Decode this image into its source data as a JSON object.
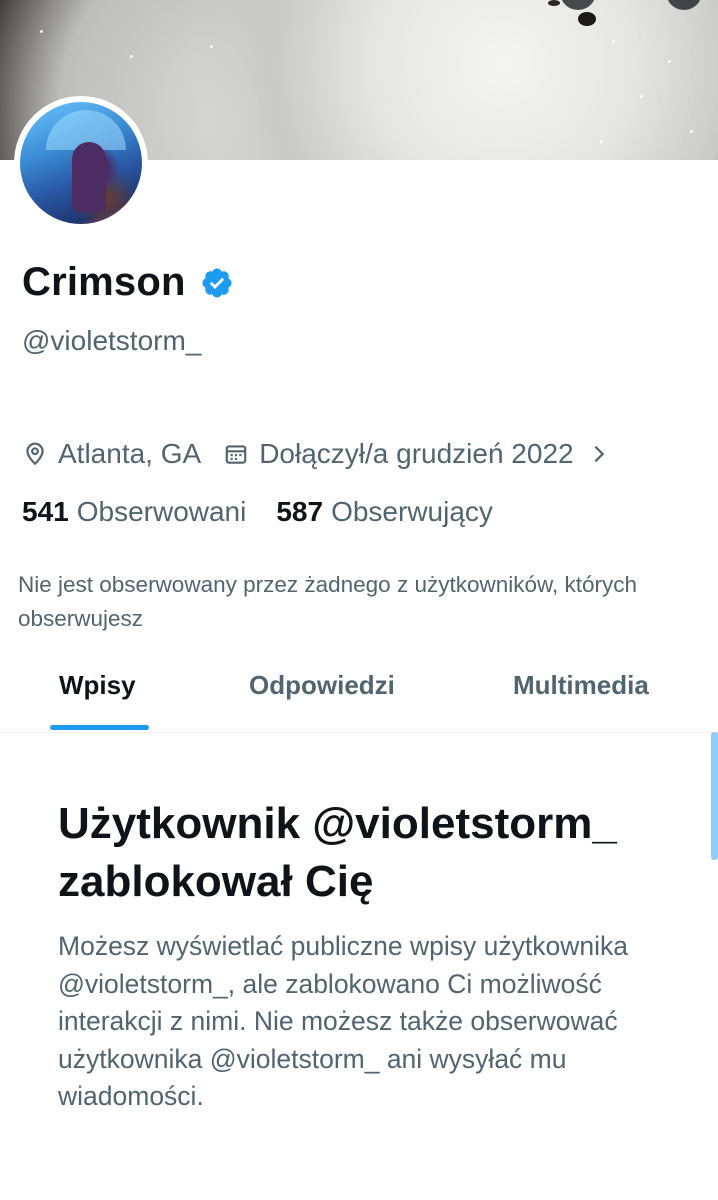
{
  "profile": {
    "display_name": "Crimson",
    "handle": "@violetstorm_",
    "location": "Atlanta, GA",
    "joined": "Dołączył/a grudzień 2022",
    "verified_icon": "verified-badge-icon",
    "verified_color": "#1d9bf0"
  },
  "counts": {
    "following_num": "541",
    "following_label": "Obserwowani",
    "followers_num": "587",
    "followers_label": "Obserwujący"
  },
  "followed_note": "Nie jest obserwowany przez żadnego z użytkowników, których obserwujesz",
  "tabs": [
    {
      "label": "Wpisy",
      "active": true
    },
    {
      "label": "Odpowiedzi",
      "active": false
    },
    {
      "label": "Multimedia",
      "active": false
    }
  ],
  "blocked": {
    "title": "Użytkownik @violetstorm_ zablokował Cię",
    "description": "Możesz wyświetlać publiczne wpisy użytkownika @violetstorm_, ale zablokowano Ci możliwość interakcji z nimi. Nie możesz także obserwować użytkownika @violetstorm_ ani wysyłać mu wiadomości."
  },
  "colors": {
    "accent": "#1d9bf0",
    "text_primary": "#0f1419",
    "text_secondary": "#536471"
  }
}
